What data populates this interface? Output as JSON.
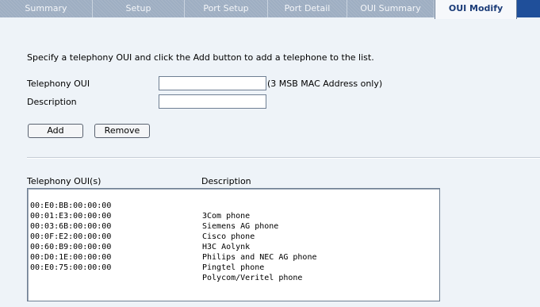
{
  "tabs": [
    {
      "label": "Summary",
      "active": false
    },
    {
      "label": "Setup",
      "active": false
    },
    {
      "label": "Port Setup",
      "active": false
    },
    {
      "label": "Port Detail",
      "active": false
    },
    {
      "label": "OUI Summary",
      "active": false
    },
    {
      "label": "OUI Modify",
      "active": true
    }
  ],
  "colors": {
    "accent": "#1f4f9a",
    "tabbar": "#9eaec2",
    "background": "#eef3f8"
  },
  "instruction": "Specify a telephony OUI and click the Add button to add a telephone to the list.",
  "form": {
    "oui_label": "Telephony OUI",
    "oui_value": "",
    "oui_hint": "(3 MSB MAC Address only)",
    "description_label": "Description",
    "description_value": ""
  },
  "buttons": {
    "add": "Add",
    "remove": "Remove"
  },
  "list": {
    "header_oui": "Telephony OUI(s)",
    "header_description": "Description",
    "rows": [
      {
        "oui": "00:E0:BB:00:00:00",
        "description": "3Com phone"
      },
      {
        "oui": "00:01:E3:00:00:00",
        "description": "Siemens AG phone"
      },
      {
        "oui": "00:03:6B:00:00:00",
        "description": "Cisco phone"
      },
      {
        "oui": "00:0F:E2:00:00:00",
        "description": "H3C Aolynk"
      },
      {
        "oui": "00:60:B9:00:00:00",
        "description": "Philips and NEC AG phone"
      },
      {
        "oui": "00:D0:1E:00:00:00",
        "description": "Pingtel phone"
      },
      {
        "oui": "00:E0:75:00:00:00",
        "description": "Polycom/Veritel phone"
      }
    ]
  }
}
